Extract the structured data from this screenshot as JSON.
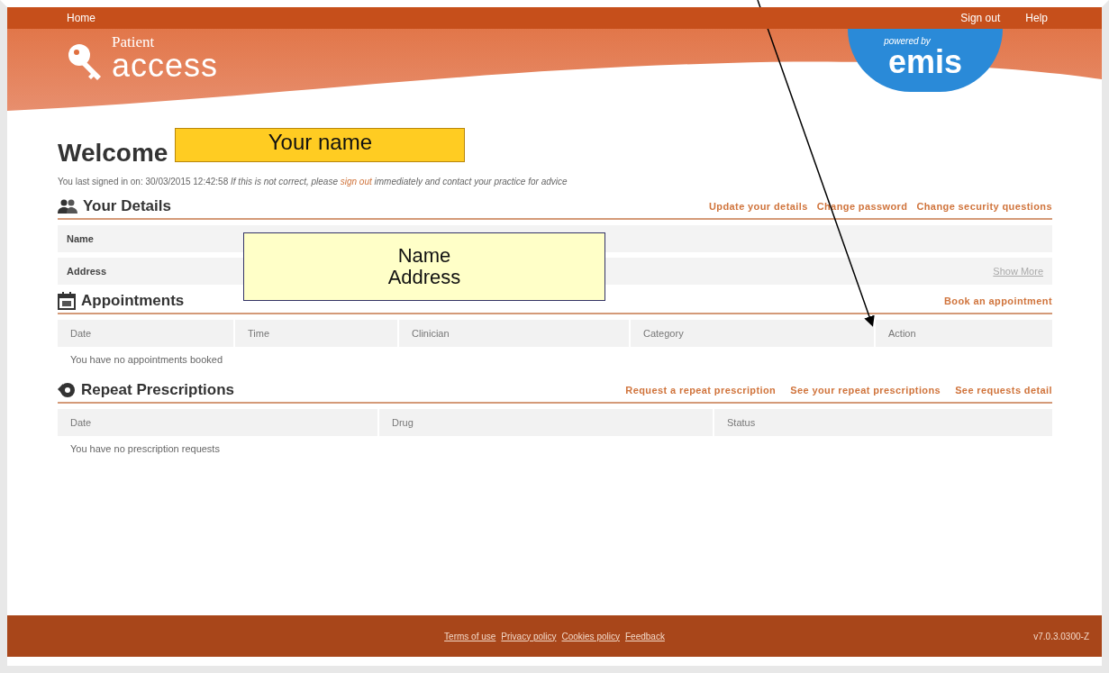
{
  "top_nav": {
    "left": [
      "Home"
    ],
    "right": [
      "Sign out",
      "Help"
    ]
  },
  "logo": {
    "small": "Patient",
    "large": "access"
  },
  "badge": {
    "small": "powered by",
    "large": "emis"
  },
  "welcome": {
    "title": "Welcome",
    "name_box": "Your name"
  },
  "last_signed": {
    "before": "You last signed in on: 30/03/2015 12:42:58 ",
    "italic1": "If this is not correct, please ",
    "link": "sign out",
    "italic2": " immediately and contact your practice for advice"
  },
  "details": {
    "title": "Your Details",
    "links": [
      "Update your details",
      "Change password",
      "Change security questions"
    ],
    "rows": [
      {
        "label": "Name"
      },
      {
        "label": "Address",
        "action": "Show More"
      }
    ],
    "overlay": [
      "Name",
      "Address"
    ]
  },
  "appointments": {
    "title": "Appointments",
    "links": [
      "Book an appointment"
    ],
    "columns": [
      "Date",
      "Time",
      "Clinician",
      "Category",
      "Action"
    ],
    "empty": "You have no appointments booked"
  },
  "prescriptions": {
    "title": "Repeat Prescriptions",
    "links": [
      "Request a repeat prescription",
      "See your repeat prescriptions",
      "See requests detail"
    ],
    "columns": [
      "Date",
      "Drug",
      "Status"
    ],
    "empty": "You have no prescription requests"
  },
  "footer": {
    "links": [
      "Terms of use",
      "Privacy policy",
      "Cookies policy",
      "Feedback"
    ],
    "version": "v7.0.3.0300-Z"
  }
}
